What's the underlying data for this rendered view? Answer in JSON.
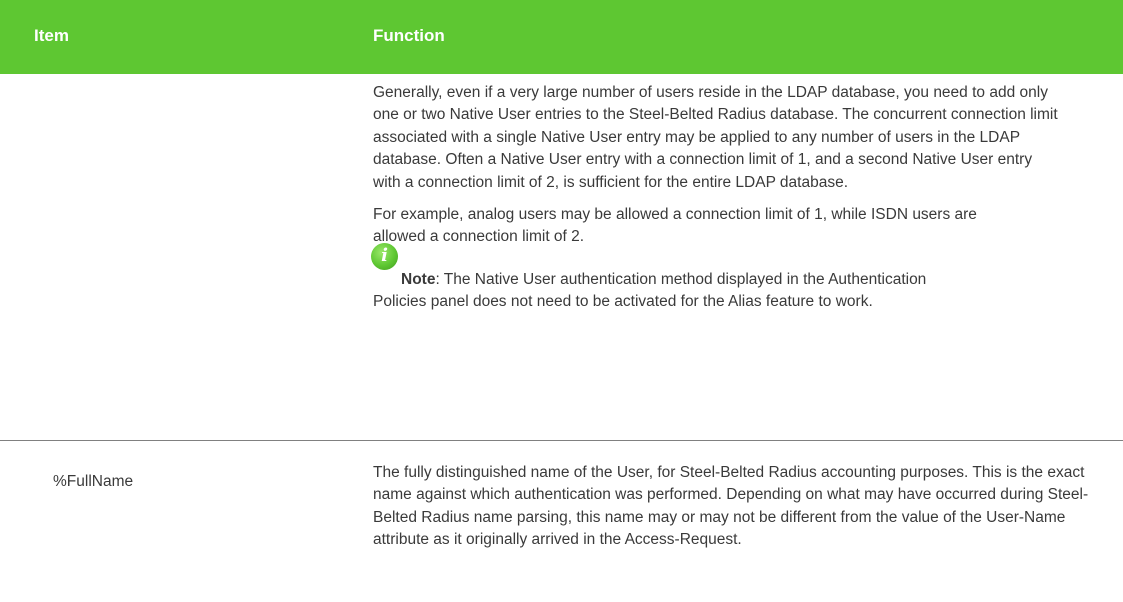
{
  "header": {
    "item_label": "Item",
    "function_label": "Function",
    "background_color": "#5ec732"
  },
  "rows": [
    {
      "item": "",
      "function": {
        "paragraph1": "Generally, even if a very large number of users reside in the LDAP database, you need to add only one or two Native User entries to the Steel-Belted Radius database. The concurrent connection limit associated with a single Native User entry may be applied to any number of users in the LDAP database. Often a Native User entry with a connection limit of 1, and a second Native User entry with a connection limit of 2, is sufficient for the entire LDAP database.",
        "paragraph2": "For example, analog users may be allowed a connection limit of 1, while ISDN users are allowed a connection limit of 2.",
        "note_icon": "info-icon",
        "note_label": "Note",
        "note_text": ": The Native User authentication method displayed in the Authentication Policies panel does not need to be activated for the Alias feature to work."
      }
    },
    {
      "item": "%FullName",
      "function": {
        "paragraph1": "The fully distinguished name of the User, for Steel-Belted Radius accounting purposes. This is the exact name against which authentication was performed. Depending on what may have occurred during Steel-Belted Radius name parsing, this name may or may not be different from the value of the User-Name attribute as it originally arrived in the Access-Request."
      }
    }
  ]
}
